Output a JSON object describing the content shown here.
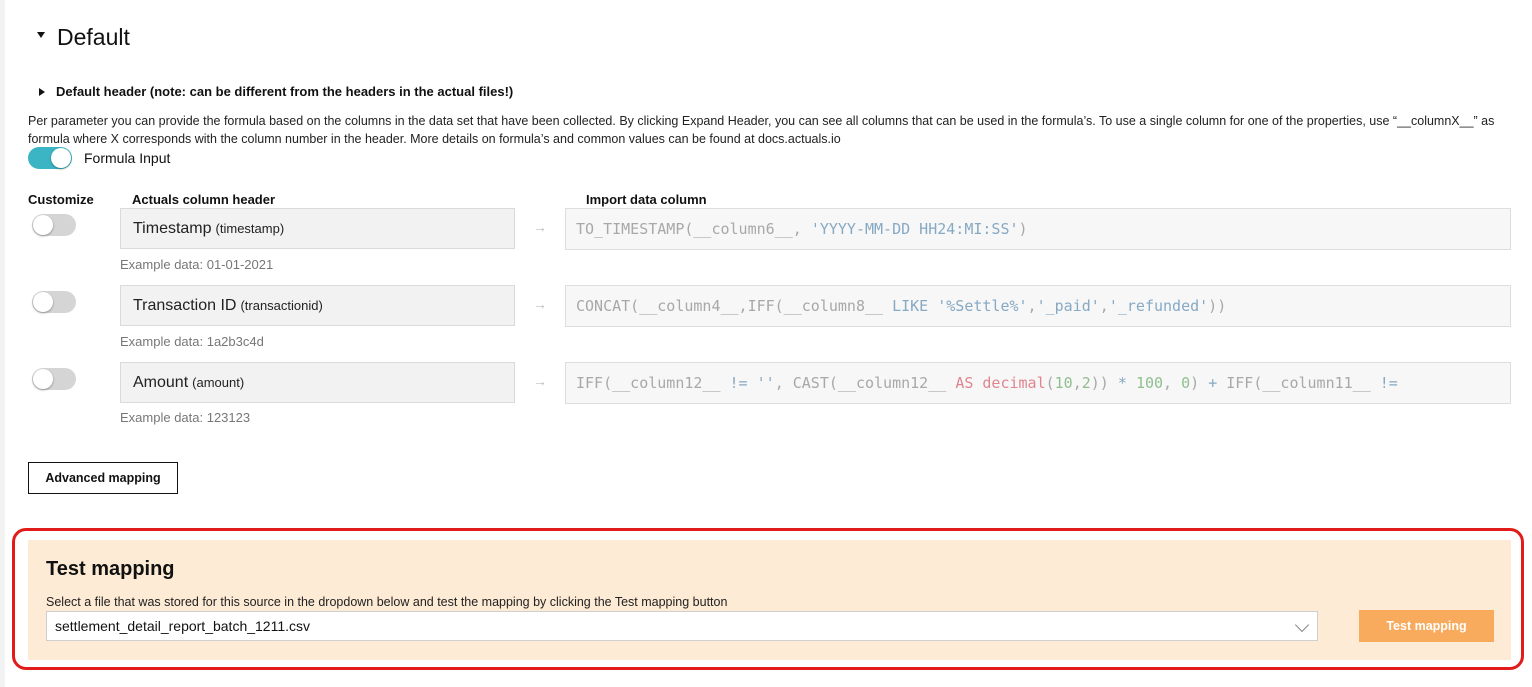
{
  "section": {
    "title": "Default",
    "default_header_label": "Default header (note: can be different from the headers in the actual files!)",
    "description": "Per parameter you can provide the formula based on the columns in the data set that have been collected. By clicking Expand Header, you can see all columns that can be used in the formula’s. To use a single column for one of the properties, use “__columnX__” as formula where X corresponds with the column number in the header. More details on formula’s and common values can be found at docs.actuals.io",
    "formula_input_label": "Formula Input",
    "formula_input_on": true
  },
  "columns": {
    "customize": "Customize",
    "actuals_header": "Actuals column header",
    "import_column": "Import data column"
  },
  "rows": [
    {
      "name": "Timestamp",
      "key": "(timestamp)",
      "example": "Example data: 01-01-2021",
      "customize_on": false,
      "formula": "TO_TIMESTAMP(__column6__, 'YYYY-MM-DD HH24:MI:SS')"
    },
    {
      "name": "Transaction ID",
      "key": "(transactionid)",
      "example": "Example data: 1a2b3c4d",
      "customize_on": false,
      "formula": "CONCAT(__column4__,IFF(__column8__ LIKE '%Settle%','_paid','_refunded'))"
    },
    {
      "name": "Amount",
      "key": "(amount)",
      "example": "Example data: 123123",
      "customize_on": false,
      "formula": "IFF(__column12__ != '', CAST(__column12__ AS decimal(10,2)) * 100, 0) + IFF(__column11__ !="
    }
  ],
  "advanced_mapping_label": "Advanced mapping",
  "test": {
    "title": "Test mapping",
    "description": "Select a file that was stored for this source in the dropdown below and test the mapping by clicking the Test mapping button",
    "selected_file": "settlement_detail_report_batch_1211.csv",
    "button_label": "Test mapping"
  },
  "colors": {
    "toggle_on": "#3bb5c3",
    "panel_bg": "#fdebd5",
    "button_orange": "#f8ab5c",
    "highlight_red": "#e21b1b"
  },
  "icons": [
    "caret-down-icon",
    "caret-right-icon",
    "arrow-right-icon",
    "chevron-down-icon"
  ]
}
